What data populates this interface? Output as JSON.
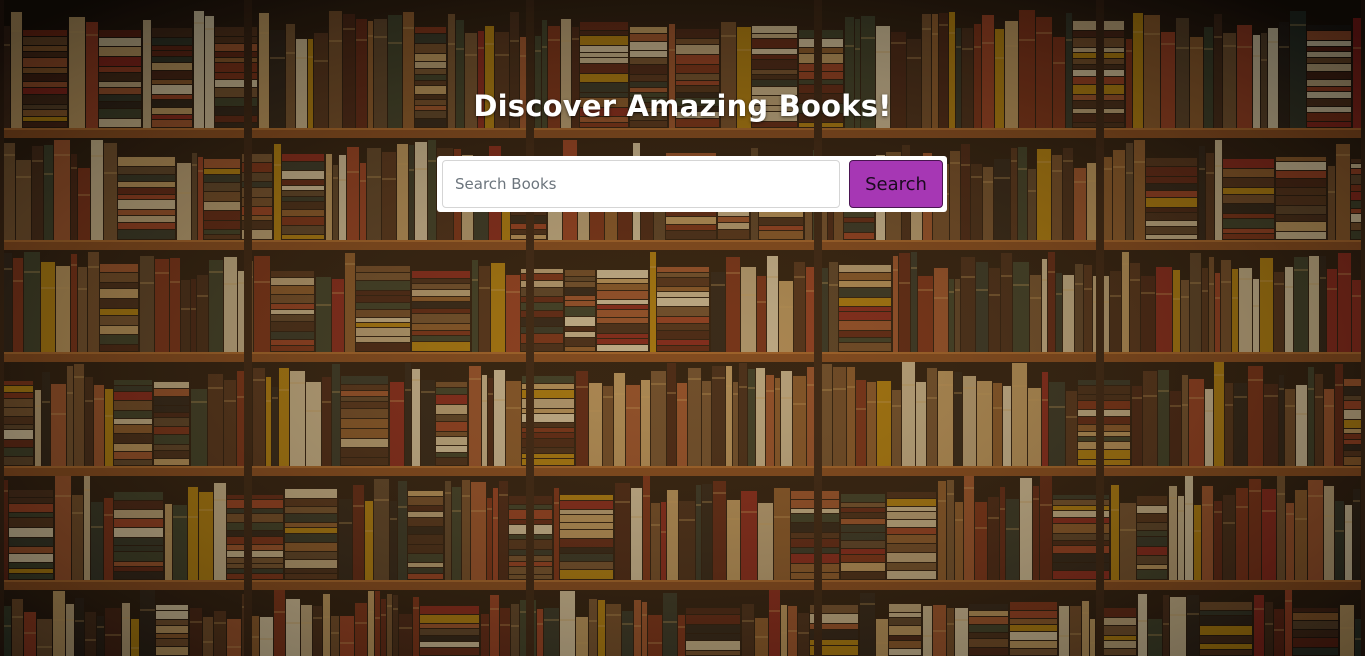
{
  "hero": {
    "title": "Discover Amazing Books!"
  },
  "search": {
    "placeholder": "Search Books",
    "value": "",
    "button_label": "Search"
  },
  "colors": {
    "accent": "#a637b4",
    "title_text": "#ffffff"
  },
  "background": {
    "image": "bookshelf-photo"
  }
}
